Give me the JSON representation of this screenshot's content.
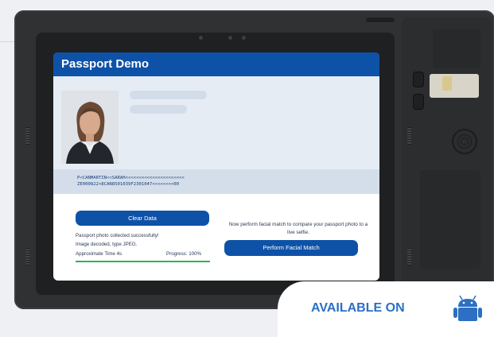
{
  "app": {
    "title": "Passport Demo"
  },
  "mrz": {
    "line1": "P<CANMARTIN<<SARAH<<<<<<<<<<<<<<<<<<<<<<",
    "line2": "ZE000822<8CAN8501039F2301047<<<<<<<<00"
  },
  "actions": {
    "clear_data_label": "Clear Data",
    "facial_match_label": "Perform Facial Match"
  },
  "status": {
    "line1": "Passport photo collected successfully!",
    "line2": "Image decoded, type JPEG.",
    "approx_time": "Approximate Time 4s",
    "progress_label": "Progress: 100%",
    "progress": 1.0
  },
  "facial_prompt": "Now perform facial match to compare your passport photo to a live selfie.",
  "badge": {
    "text": "AVAILABLE ON",
    "icon": "android-icon"
  },
  "colors": {
    "brand_blue": "#0e52a8",
    "progress_green": "#2fb15a",
    "badge_blue": "#2c6fc4"
  }
}
